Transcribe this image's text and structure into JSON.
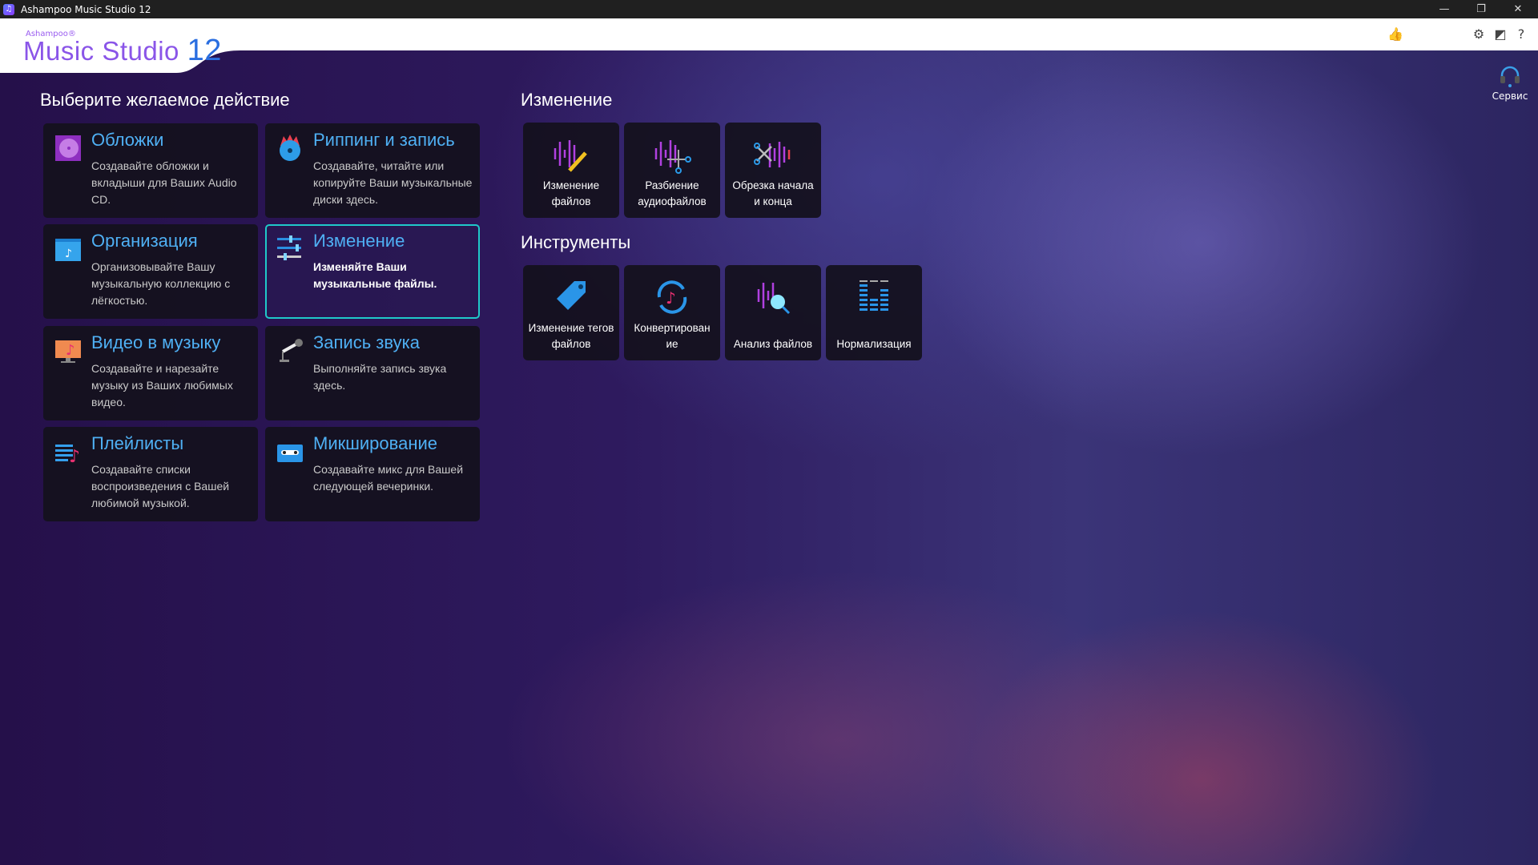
{
  "window": {
    "title": "Ashampoo Music Studio 12",
    "minimize": "—",
    "maximize": "❐",
    "close": "✕"
  },
  "logo": {
    "brand": "Ashampoo®",
    "product": "Music Studio",
    "version": "12"
  },
  "header": {
    "thumbs_icon": "👍",
    "settings_icon": "⚙",
    "theme_icon": "◩",
    "help_icon": "?"
  },
  "service": {
    "label": "Сервис"
  },
  "left": {
    "heading": "Выберите желаемое действие",
    "cards": [
      {
        "title": "Обложки",
        "desc": "Создавайте обложки и вкладыши для Ваших Audio CD."
      },
      {
        "title": "Риппинг и запись",
        "desc": "Создавайте, читайте или копируйте Ваши музыкальные диски здесь."
      },
      {
        "title": "Организация",
        "desc": "Организовывайте Вашу музыкальную коллекцию с лёгкостью."
      },
      {
        "title": "Изменение",
        "desc": "Изменяйте Ваши музыкальные файлы."
      },
      {
        "title": "Видео в музыку",
        "desc": "Создавайте и нарезайте музыку из Ваших любимых видео."
      },
      {
        "title": "Запись звука",
        "desc": "Выполняйте запись звука здесь."
      },
      {
        "title": "Плейлисты",
        "desc": "Создавайте списки воспроизведения с Вашей любимой музыкой."
      },
      {
        "title": "Микширование",
        "desc": "Создавайте микс для Вашей следующей вечеринки."
      }
    ]
  },
  "edit": {
    "heading": "Изменение",
    "tiles": [
      "Изменение файлов",
      "Разбиение аудиофайлов",
      "Обрезка начала и конца"
    ]
  },
  "tools": {
    "heading": "Инструменты",
    "tiles": [
      "Изменение тегов файлов",
      "Конвертирован ие",
      "Анализ файлов",
      "Нормализация"
    ]
  },
  "colors": {
    "accent": "#4fb0f4",
    "selected_border": "#1fc9c9",
    "logo_purple": "#8a55e8",
    "logo_blue": "#2a6ee0"
  }
}
